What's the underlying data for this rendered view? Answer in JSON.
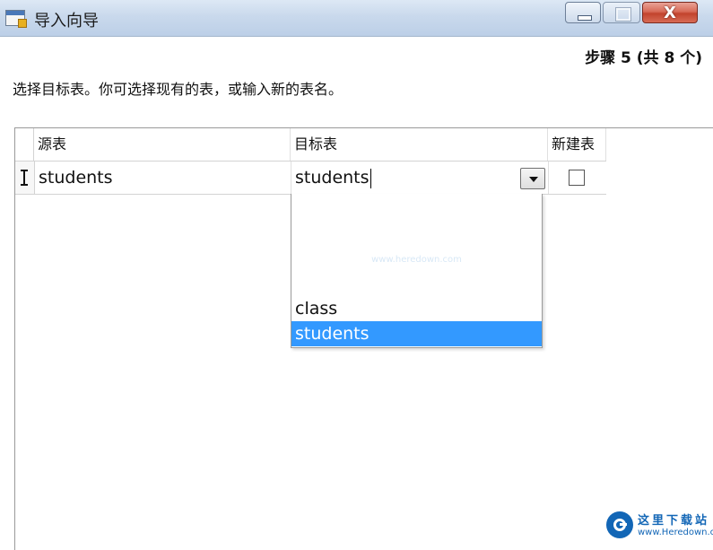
{
  "window": {
    "title": "导入向导",
    "controls": {
      "minimize": "minimize",
      "maximize": "maximize",
      "close_label": "X"
    }
  },
  "step_label": "步骤 5 (共 8 个)",
  "instruction": "选择目标表。你可选择现有的表，或输入新的表名。",
  "grid": {
    "columns": [
      "源表",
      "目标表",
      "新建表"
    ],
    "rows": [
      {
        "source": "students",
        "target": "students",
        "new_table": false
      }
    ]
  },
  "dropdown": {
    "watermark": "www.heredown.com",
    "options": [
      "class",
      "students"
    ],
    "selected": "students"
  },
  "watermark_badge": {
    "title": "这里下载站",
    "url": "www.Heredown.com"
  },
  "colors": {
    "selection": "#3399ff",
    "close_button": "#c2432d",
    "badge": "#1266b6"
  }
}
